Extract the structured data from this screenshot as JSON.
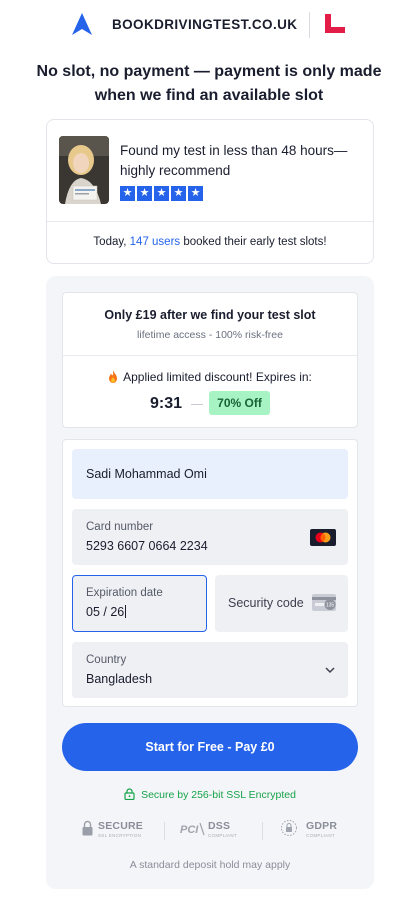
{
  "header": {
    "brand": "BOOKDRIVINGTEST.CO.UK",
    "logo_icon": "arrow-up-logo-icon",
    "plate_icon": "l-plate-icon",
    "brand_color": "#2563eb",
    "plate_color": "#e11d48"
  },
  "headline": "No slot, no payment — payment is only made when we find an available slot",
  "review": {
    "text": "Found my test in less than 48 hours— highly recommend",
    "stars": [
      "★",
      "★",
      "★",
      "★",
      "★"
    ],
    "today_prefix": "Today, ",
    "today_highlight": "147 users",
    "today_suffix": " booked their early test slots!"
  },
  "offer": {
    "title": "Only £19 after we find your test slot",
    "subtitle": "lifetime access - 100% risk-free",
    "discount_text": "Applied limited discount! Expires in:",
    "timer": "9:31",
    "badge": "70% Off"
  },
  "form": {
    "name_value": "Sadi Mohammad Omi",
    "card_label": "Card number",
    "card_value": "5293 6607 0664 2234",
    "exp_label": "Expiration date",
    "exp_value": "05 / 26",
    "security_placeholder": "Security code",
    "cvc_icon_text": "135",
    "country_label": "Country",
    "country_value": "Bangladesh"
  },
  "pay_button": "Start for Free - Pay £0",
  "ssl_text": "Secure by 256-bit SSL Encrypted",
  "trust_badges": [
    {
      "title": "SECURE",
      "sub": "SSL ENCRYPTION",
      "icon": "padlock-icon"
    },
    {
      "title": "DSS",
      "sub": "COMPLIANT",
      "icon": "pci-icon",
      "icon_text": "PCI"
    },
    {
      "title": "GDPR",
      "sub": "COMPLIANT",
      "icon": "gdpr-shield-icon"
    }
  ],
  "deposit_note": "A standard deposit hold may apply"
}
